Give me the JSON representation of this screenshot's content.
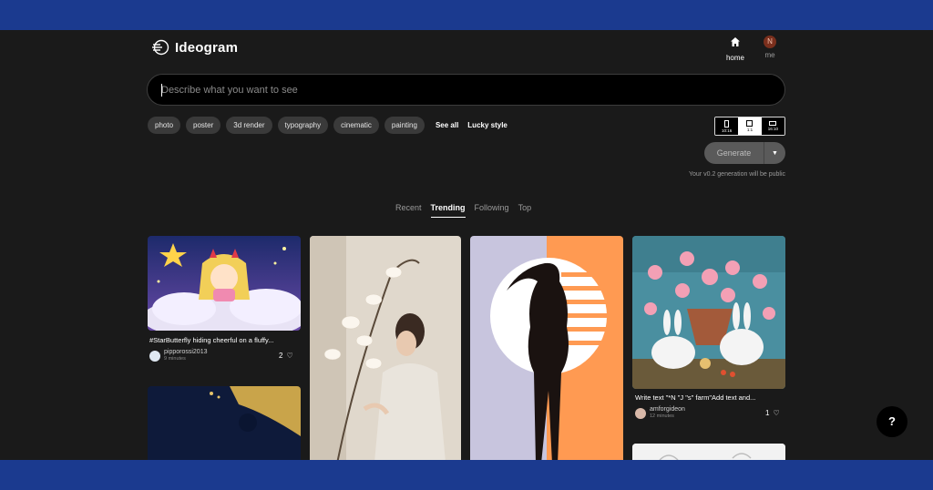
{
  "header": {
    "logo_text": "Ideogram",
    "nav": {
      "home_label": "home",
      "me_label": "me",
      "avatar_initial": "N"
    }
  },
  "search": {
    "placeholder": "Describe what you want to see"
  },
  "style_chips": [
    "photo",
    "poster",
    "3d render",
    "typography",
    "cinematic",
    "painting"
  ],
  "links": {
    "see_all": "See all",
    "lucky_style": "Lucky style"
  },
  "aspect_ratios": [
    {
      "label": "10:16",
      "selected": false
    },
    {
      "label": "1:1",
      "selected": true
    },
    {
      "label": "16:10",
      "selected": false
    }
  ],
  "generate": {
    "label": "Generate",
    "note": "Your v0.2 generation will be public"
  },
  "tabs": [
    {
      "label": "Recent",
      "active": false
    },
    {
      "label": "Trending",
      "active": true
    },
    {
      "label": "Following",
      "active": false
    },
    {
      "label": "Top",
      "active": false
    }
  ],
  "cards": {
    "star": {
      "caption": "#StarButterfly hiding cheerful on a fluffy...",
      "user": "pipporossi2013",
      "time": "9 minutes",
      "likes": "2"
    },
    "rabbits": {
      "caption": "Write text \"*N \"J \"s\" farm\"Add text and...",
      "user": "amforgideon",
      "time": "12 minutes",
      "likes": "1"
    }
  },
  "help": {
    "label": "?"
  },
  "colors": {
    "frame": "#1b3a8f",
    "app_bg": "#1a1a1a",
    "accent_orange": "#ff9a52"
  }
}
